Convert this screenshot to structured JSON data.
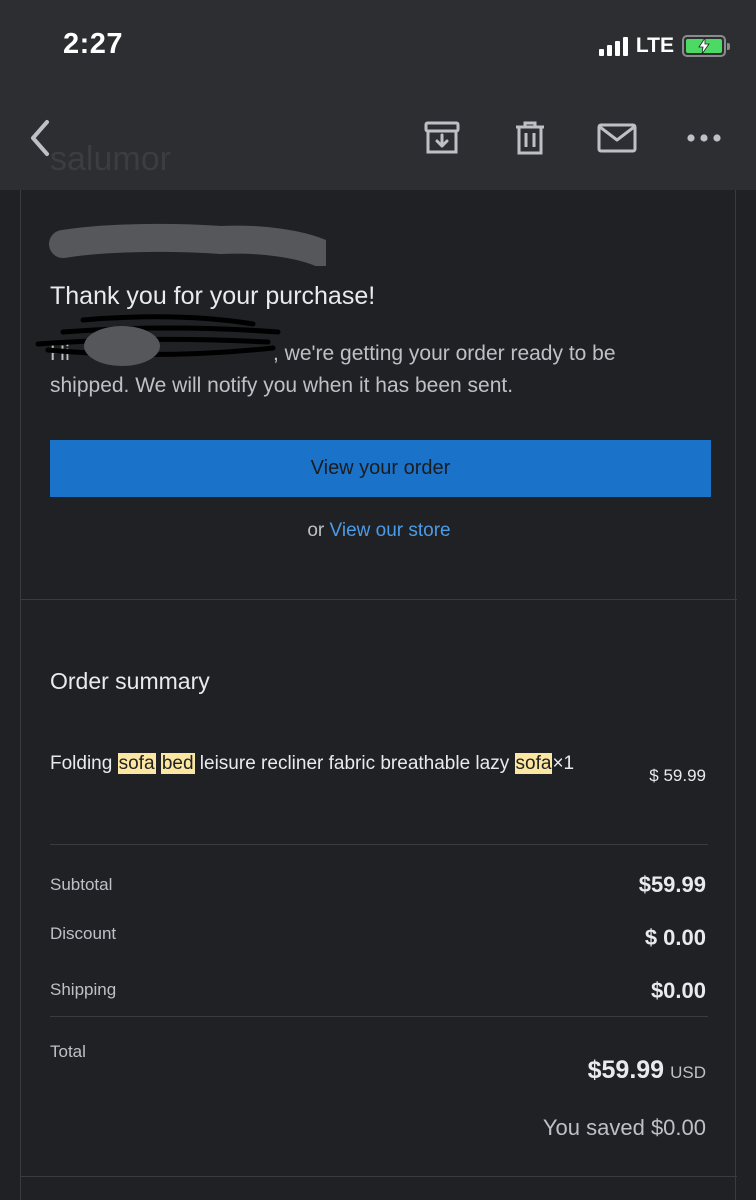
{
  "status_bar": {
    "time": "2:27",
    "network": "LTE",
    "signal_bars": 4,
    "battery_icon": "battery-charging-icon",
    "battery_color": "#4cd964"
  },
  "header": {
    "sender_partial": "salumor",
    "actions": [
      {
        "name": "back",
        "icon": "chevron-left-icon"
      },
      {
        "name": "archive",
        "icon": "archive-icon"
      },
      {
        "name": "delete",
        "icon": "trash-icon"
      },
      {
        "name": "mark-unread",
        "icon": "mail-icon"
      },
      {
        "name": "more",
        "icon": "more-horizontal-icon"
      }
    ]
  },
  "email": {
    "headline": "Thank you for your purchase!",
    "greeting_prefix": "Hi",
    "greeting_body": ", we're getting your order ready to be shipped. We will notify you when it has been sent.",
    "cta_label": "View your order",
    "store_prefix": "or",
    "store_link": "View our store",
    "accent_color": "#1a73c8",
    "link_color": "#4a9be8"
  },
  "order_summary": {
    "title": "Order summary",
    "item": {
      "segments": [
        {
          "text": "Folding ",
          "highlight": false
        },
        {
          "text": "sofa",
          "highlight": true
        },
        {
          "text": " ",
          "highlight": false
        },
        {
          "text": "bed",
          "highlight": true
        },
        {
          "text": " leisure recliner fabric breathable lazy ",
          "highlight": false
        },
        {
          "text": "sofa",
          "highlight": true
        },
        {
          "text": "×1",
          "highlight": false
        }
      ],
      "price": "$ 59.99"
    },
    "subtotal_label": "Subtotal",
    "subtotal_value": "$59.99",
    "discount_label": "Discount",
    "discount_value": "$ 0.00",
    "shipping_label": "Shipping",
    "shipping_value": "$0.00",
    "total_label": "Total",
    "total_value": "$59.99",
    "total_currency": "USD",
    "saved_text": "You saved $0.00"
  }
}
